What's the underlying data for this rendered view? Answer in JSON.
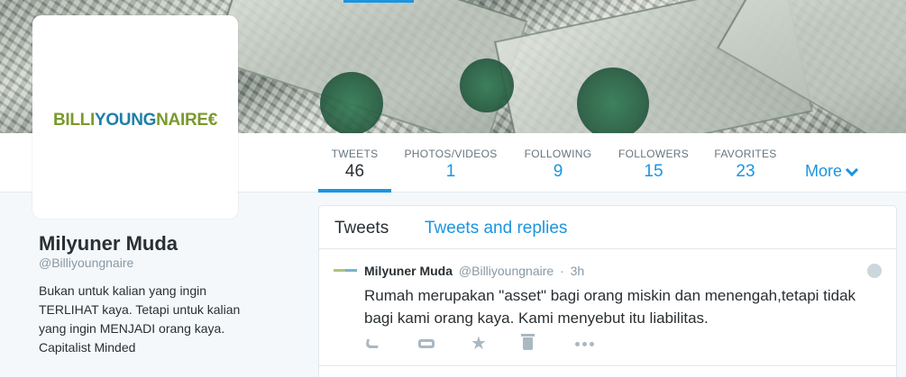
{
  "profile": {
    "logo_part1": "BILLI",
    "logo_part2": "YOUNG",
    "logo_part3": "NAIRE",
    "logo_part4": "€",
    "name": "Milyuner Muda",
    "handle": "@Billiyoungnaire",
    "bio_lines": [
      "Bukan untuk kalian yang ingin",
      "TERLIHAT kaya. Tetapi untuk kalian",
      "yang ingin MENJADI orang kaya.",
      "Capitalist Minded"
    ]
  },
  "nav": {
    "stats": [
      {
        "label": "TWEETS",
        "value": "46"
      },
      {
        "label": "PHOTOS/VIDEOS",
        "value": "1"
      },
      {
        "label": "FOLLOWING",
        "value": "9"
      },
      {
        "label": "FOLLOWERS",
        "value": "15"
      },
      {
        "label": "FAVORITES",
        "value": "23"
      }
    ],
    "more_label": "More"
  },
  "timeline": {
    "tabs": [
      "Tweets",
      "Tweets and replies"
    ],
    "tweet": {
      "name": "Milyuner Muda",
      "handle": "@Billiyoungnaire",
      "separator": "·",
      "time": "3h",
      "text": "Rumah merupakan \"asset\" bagi orang miskin dan menengah,tetapi tidak bagi kami orang kaya. Kami menyebut itu liabilitas."
    }
  },
  "icons": {
    "reply": "reply-icon",
    "retweet": "retweet-icon",
    "favorite": "star-icon",
    "delete": "trash-icon",
    "more": "more-dots-icon",
    "privacy": "globe-icon"
  },
  "colors": {
    "accent": "#1b95e0",
    "logo_green": "#7a9a2c",
    "logo_blue": "#1e7fa8",
    "text": "#292f33",
    "muted": "#8899a6"
  }
}
